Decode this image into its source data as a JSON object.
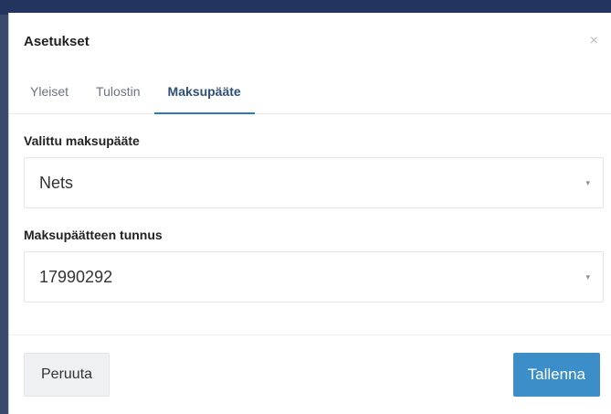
{
  "modal": {
    "title": "Asetukset",
    "close_label": "×"
  },
  "tabs": [
    {
      "label": "Yleiset",
      "active": false
    },
    {
      "label": "Tulostin",
      "active": false
    },
    {
      "label": "Maksupääte",
      "active": true
    }
  ],
  "fields": {
    "terminal": {
      "label": "Valittu maksupääte",
      "value": "Nets"
    },
    "terminal_id": {
      "label": "Maksupäätteen tunnus",
      "value": "17990292"
    }
  },
  "icons": {
    "dropdown": "▾"
  },
  "footer": {
    "cancel_label": "Peruuta",
    "save_label": "Tallenna"
  },
  "colors": {
    "accent": "#3b8ec7",
    "active_tab_text": "#2d4f78",
    "active_tab_underline": "#2e7bb4"
  }
}
